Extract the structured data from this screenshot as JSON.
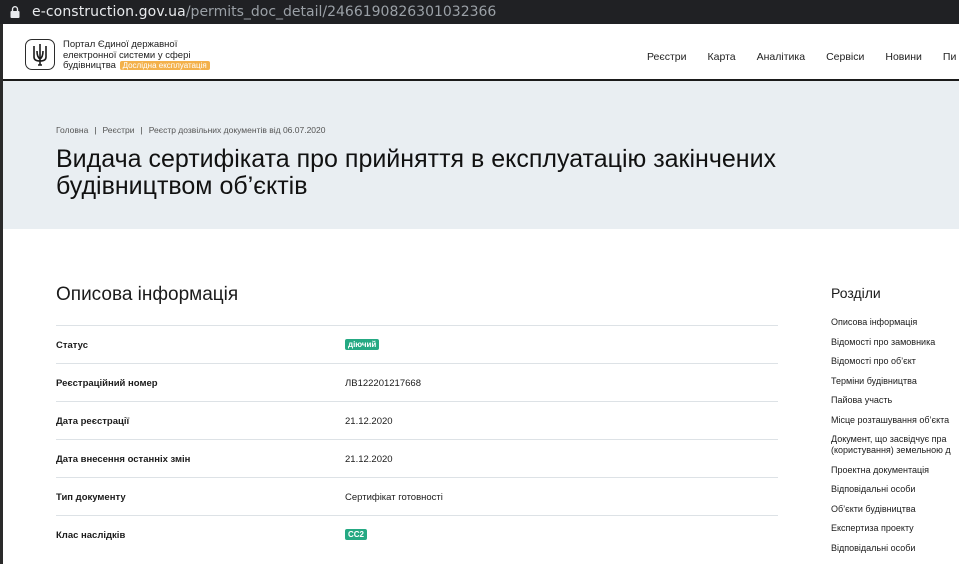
{
  "browser": {
    "domain": "e-construction.gov.ua",
    "path": "/permits_doc_detail/2466190826301032366"
  },
  "header": {
    "portal_name": "Портал Єдиної державної електронної системи у сфері будівництва",
    "badge": "Дослідна експлуатація",
    "nav": [
      "Реєстри",
      "Карта",
      "Аналітика",
      "Сервіси",
      "Новини",
      "Пи"
    ]
  },
  "breadcrumb": [
    "Головна",
    "Реєстри",
    "Реєстр дозвільних документів від 06.07.2020"
  ],
  "page_title_line1": "Видача сертифіката про прийняття в експлуатацію закінчених",
  "page_title_line2": "будівництвом об’єктів",
  "info": {
    "title": "Описова інформація",
    "rows": [
      {
        "label": "Статус",
        "value": "діючий",
        "badge": true
      },
      {
        "label": "Реєстраційний номер",
        "value": "ЛВ122201217668"
      },
      {
        "label": "Дата реєстрації",
        "value": "21.12.2020"
      },
      {
        "label": "Дата внесення останніх змін",
        "value": "21.12.2020"
      },
      {
        "label": "Тип документу",
        "value": "Сертифікат готовності"
      },
      {
        "label": "Клас наслідків",
        "value": "СС2",
        "badge": true
      }
    ]
  },
  "sidebar": {
    "title": "Розділи",
    "items": [
      "Описова інформація",
      "Відомості про замовника",
      "Відомості про об’єкт",
      "Терміни будівництва",
      "Пайова участь",
      "Місце розташування об’єкта",
      "Документ, що засвідчує пра",
      "(користування) земельною д",
      "Проектна документація",
      "Відповідальні особи",
      "Об’єкти будівництва",
      "Експертиза проекту",
      "Відповідальні особи"
    ]
  },
  "colors": {
    "hero_bg": "#e9eef2",
    "badge_green": "#25a983",
    "badge_orange": "#f3b14b"
  }
}
